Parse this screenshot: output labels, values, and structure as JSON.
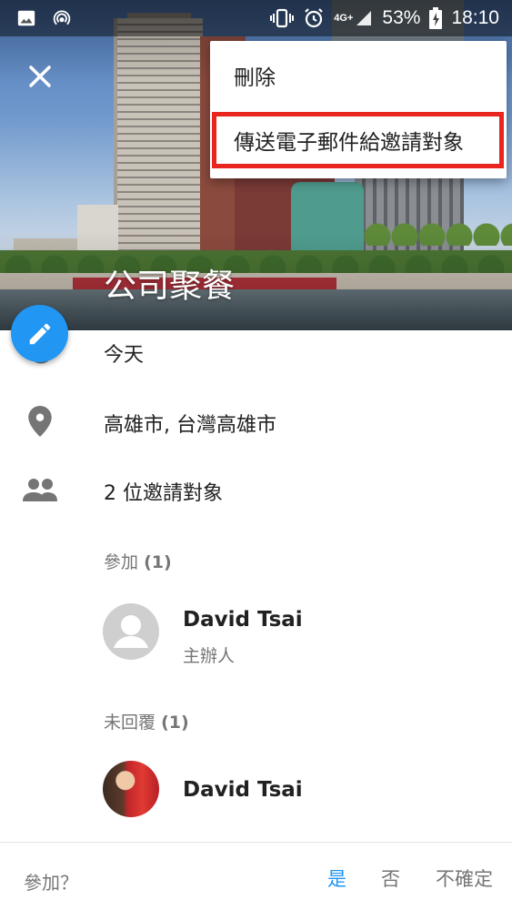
{
  "status_bar": {
    "network_badge": "4G+",
    "battery": "53%",
    "time": "18:10",
    "icons": [
      "image-icon",
      "hotspot-icon",
      "vibrate-icon",
      "alarm-icon",
      "signal-icon",
      "battery-charging-icon"
    ]
  },
  "header": {
    "close_icon": "close-icon",
    "title": "公司聚餐"
  },
  "menu": {
    "delete": "刪除",
    "email_guests": "傳送電子郵件給邀請對象"
  },
  "details": {
    "date": "今天",
    "location": "高雄市, 台灣高雄市",
    "guests_summary": "2 位邀請對象"
  },
  "attending": {
    "label": "參加",
    "count": "(1)",
    "guests": [
      {
        "name": "David Tsai",
        "role": "主辦人"
      }
    ]
  },
  "no_reply": {
    "label": "未回覆",
    "count": "(1)",
    "guests": [
      {
        "name": "David Tsai"
      }
    ]
  },
  "rsvp": {
    "question": "參加？",
    "yes": "是",
    "no": "否",
    "maybe": "不確定"
  },
  "colors": {
    "accent": "#2196f3",
    "highlight_border": "#e8261f",
    "secondary_text": "#757575"
  }
}
